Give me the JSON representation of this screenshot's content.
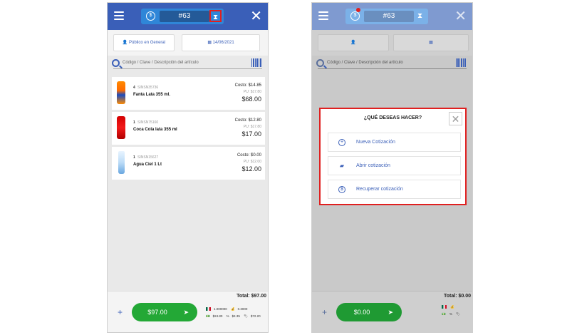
{
  "left": {
    "order_number": "#63",
    "client_label": "Público en General",
    "date_label": "14/06/2021",
    "search_placeholder": "Código / Clave / Descripción del artículo",
    "products": [
      {
        "qty": "4",
        "sku": "SINSN35736",
        "name": "Fanta Lata 355 ml.",
        "cost": "Costo: $14.85",
        "pu": "PU: $17.80",
        "total": "$68.00"
      },
      {
        "qty": "1",
        "sku": "SINSN75160",
        "name": "Coca Cola lata 355 ml",
        "cost": "Costo: $12.80",
        "pu": "PU: $17.80",
        "total": "$17.00"
      },
      {
        "qty": "1",
        "sku": "SINSN15627",
        "name": "Agua Ciel 1 Lt",
        "cost": "Costo: $0.00",
        "pu": "PU: $12.00",
        "total": "$12.00"
      }
    ],
    "total_label": "Total: $97.00",
    "pay_amount": "$97.00",
    "rates": {
      "r1": "1.000000",
      "r2": "0.3000",
      "r3": "$24.80",
      "r4": "$4.35",
      "r5": "$72.20"
    }
  },
  "right": {
    "order_number": "#63",
    "search_placeholder": "Código / Clave / Descripción del artículo",
    "total_label": "Total: $0.00",
    "pay_amount": "$0.00",
    "modal": {
      "title": "¿QUÉ DESEAS HACER?",
      "options": [
        {
          "label": "Nueva Cotización",
          "icon": "plus-circle-icon"
        },
        {
          "label": "Abrir cotización",
          "icon": "folder-open-icon"
        },
        {
          "label": "Recuperar cotización",
          "icon": "recover-icon"
        }
      ]
    }
  },
  "colors": {
    "primary": "#3a5fb8",
    "pill": "#2f86d8",
    "green": "#23a836",
    "highlight": "#e02020"
  }
}
